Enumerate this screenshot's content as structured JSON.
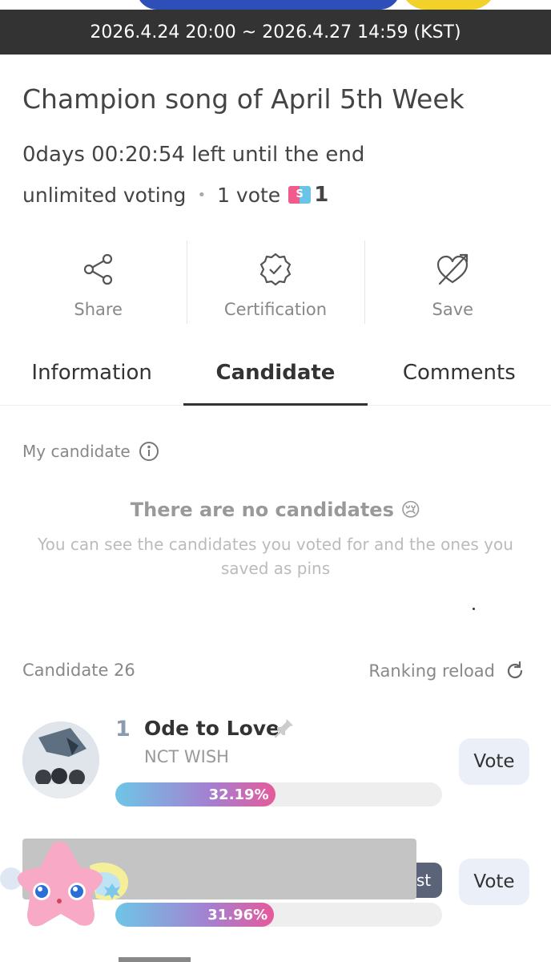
{
  "header": {
    "date_range": "2026.4.24 20:00 ~ 2026.4.27 14:59 (KST)"
  },
  "event": {
    "title": "Champion song of April 5th Week",
    "time_left": "0days 00:20:54 left until the end",
    "voting_type": "unlimited voting",
    "vote_cost": "1 vote",
    "ticket_icon": "ticket-icon",
    "ticket_count": "1"
  },
  "actions": [
    {
      "label": "Share",
      "icon": "share-icon"
    },
    {
      "label": "Certification",
      "icon": "badge-check-icon"
    },
    {
      "label": "Save",
      "icon": "heart-arrow-icon"
    }
  ],
  "tabs": [
    {
      "label": "Information",
      "active": false
    },
    {
      "label": "Candidate",
      "active": true
    },
    {
      "label": "Comments",
      "active": false
    }
  ],
  "my_candidate": {
    "label": "My candidate",
    "empty_title": "There are no candidates 😢",
    "empty_desc": "You can see the candidates you voted for and the ones you saved as pins"
  },
  "candidates_header": {
    "count_label": "Candidate 26",
    "reload_label": "Ranking reload"
  },
  "candidates": [
    {
      "rank": "1",
      "song": "Ode to Love",
      "artist": "NCT WISH",
      "percent_label": "32.19%",
      "percent": 32.19,
      "vote_label": "Vote"
    },
    {
      "rank": "",
      "song": "",
      "artist": "",
      "tag_partial": "st",
      "percent_label": "31.96%",
      "percent": 31.96,
      "vote_label": "Vote"
    }
  ],
  "colors": {
    "date_bar": "#333333",
    "bar_gradient_start": "#6ec6e6",
    "bar_gradient_end": "#e65a9a",
    "vote_button_bg": "#ebf0f8",
    "rank_color": "#8c9aae"
  }
}
